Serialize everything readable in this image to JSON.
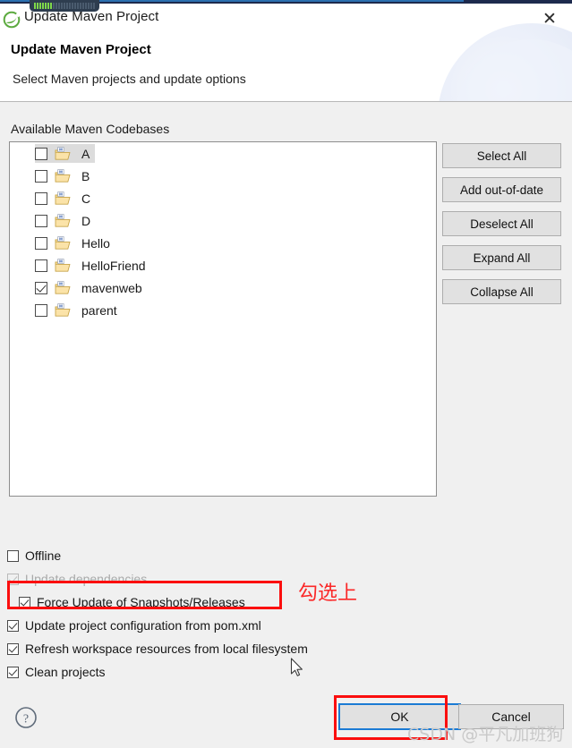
{
  "window": {
    "title": "Update Maven Project",
    "icon": "spring-leaf-icon",
    "close_label": "✕"
  },
  "header": {
    "page_title": "Update Maven Project",
    "subtitle": "Select Maven projects and update options"
  },
  "tree": {
    "group_label": "Available Maven Codebases",
    "items": [
      {
        "label": "A",
        "checked": false,
        "selected": true
      },
      {
        "label": "B",
        "checked": false,
        "selected": false
      },
      {
        "label": "C",
        "checked": false,
        "selected": false
      },
      {
        "label": "D",
        "checked": false,
        "selected": false
      },
      {
        "label": "Hello",
        "checked": false,
        "selected": false
      },
      {
        "label": "HelloFriend",
        "checked": false,
        "selected": false
      },
      {
        "label": "mavenweb",
        "checked": true,
        "selected": false
      },
      {
        "label": "parent",
        "checked": false,
        "selected": false
      }
    ]
  },
  "side_buttons": [
    {
      "label": "Select All"
    },
    {
      "label": "Add out-of-date"
    },
    {
      "label": "Deselect All"
    },
    {
      "label": "Expand All"
    },
    {
      "label": "Collapse All"
    }
  ],
  "options": [
    {
      "label": "Offline",
      "checked": false,
      "enabled": true,
      "indented": false
    },
    {
      "label": "Update dependencies",
      "checked": true,
      "enabled": false,
      "indented": false
    },
    {
      "label": "Force Update of Snapshots/Releases",
      "checked": true,
      "enabled": true,
      "indented": true
    },
    {
      "label": "Update project configuration from pom.xml",
      "checked": true,
      "enabled": true,
      "indented": false
    },
    {
      "label": "Refresh workspace resources from local filesystem",
      "checked": true,
      "enabled": true,
      "indented": false
    },
    {
      "label": "Clean projects",
      "checked": true,
      "enabled": true,
      "indented": false
    }
  ],
  "annotations": {
    "note_text": "勾选上",
    "note_color": "#fb2828",
    "box_color": "#fb0e0e"
  },
  "footer": {
    "help_label": "?",
    "ok_label": "OK",
    "cancel_label": "Cancel"
  },
  "watermark": {
    "text": "CSDN @平凡加班狗"
  },
  "colors": {
    "dialog_bg": "#f0f0f0",
    "header_bg": "#ffffff",
    "button_bg": "#e1e1e1",
    "focus_blue": "#1b7bd4",
    "annotation_red": "#fb0e0e",
    "selection_gray": "#dcdcdc"
  }
}
